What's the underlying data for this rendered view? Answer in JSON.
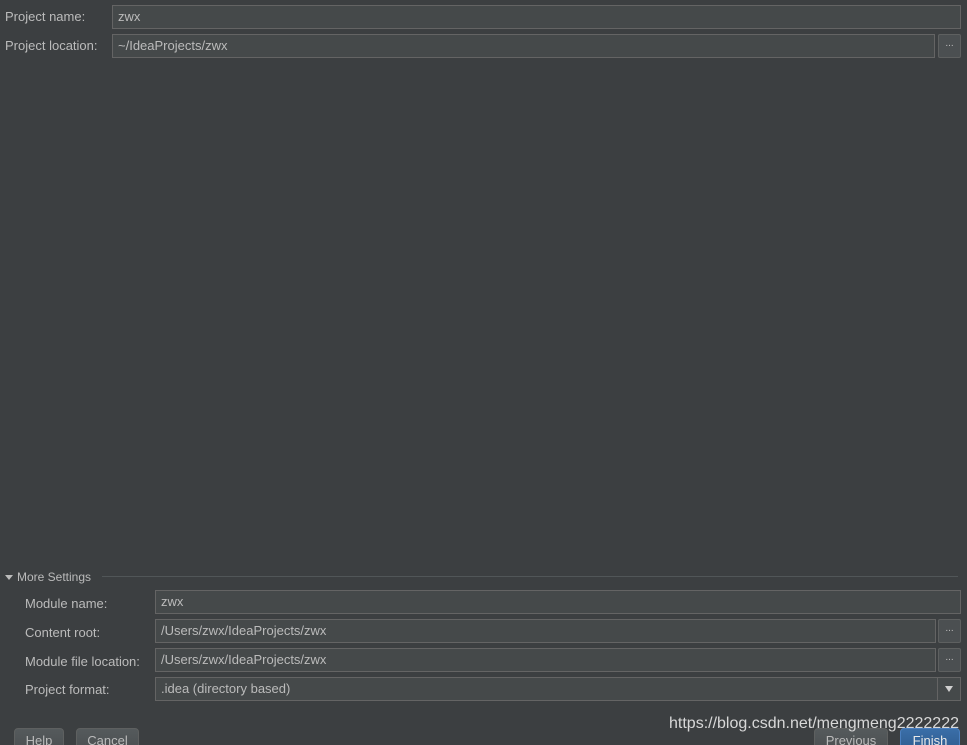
{
  "project": {
    "name_label": "Project name:",
    "name_value": "zwx",
    "location_label": "Project location:",
    "location_value": "~/IdeaProjects/zwx",
    "browse_label": "..."
  },
  "more_settings": {
    "title": "More Settings",
    "module_name_label": "Module name:",
    "module_name_value": "zwx",
    "content_root_label": "Content root:",
    "content_root_value": "/Users/zwx/IdeaProjects/zwx",
    "module_file_label": "Module file location:",
    "module_file_value": "/Users/zwx/IdeaProjects/zwx",
    "format_label": "Project format:",
    "format_value": ".idea (directory based)",
    "browse_label": "..."
  },
  "buttons": {
    "help": "Help",
    "cancel": "Cancel",
    "previous": "Previous",
    "finish": "Finish"
  },
  "watermark": "https://blog.csdn.net/mengmeng2222222"
}
